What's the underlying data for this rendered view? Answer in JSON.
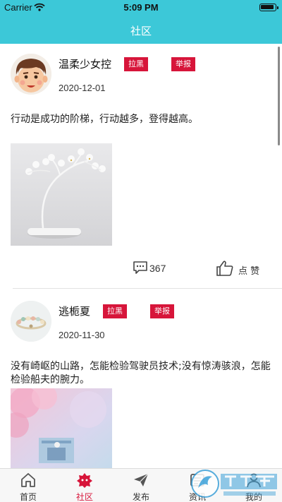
{
  "status_bar": {
    "carrier": "Carrier",
    "time": "5:09 PM"
  },
  "header": {
    "title": "社区"
  },
  "posts": [
    {
      "username": "温柔少女控",
      "block_label": "拉黑",
      "report_label": "举报",
      "date": "2020-12-01",
      "content": "行动是成功的阶梯，行动越多，登得越高。",
      "comment_count": "367",
      "like_label": "点 赞"
    },
    {
      "username": "逃栀夏",
      "block_label": "拉黑",
      "report_label": "举报",
      "date": "2020-11-30",
      "content": "没有崎岖的山路，怎能检验驾驶员技术;没有惊涛骇浪，怎能检验船夫的腕力。"
    }
  ],
  "tabs": [
    {
      "label": "首页",
      "icon": "home-icon"
    },
    {
      "label": "社区",
      "icon": "community-icon",
      "active": true
    },
    {
      "label": "发布",
      "icon": "send-icon"
    },
    {
      "label": "资讯",
      "icon": "news-icon"
    },
    {
      "label": "我的",
      "icon": "profile-icon"
    }
  ],
  "colors": {
    "header": "#3cc8d8",
    "badge": "#d7153a",
    "active_tab": "#d7153a"
  }
}
